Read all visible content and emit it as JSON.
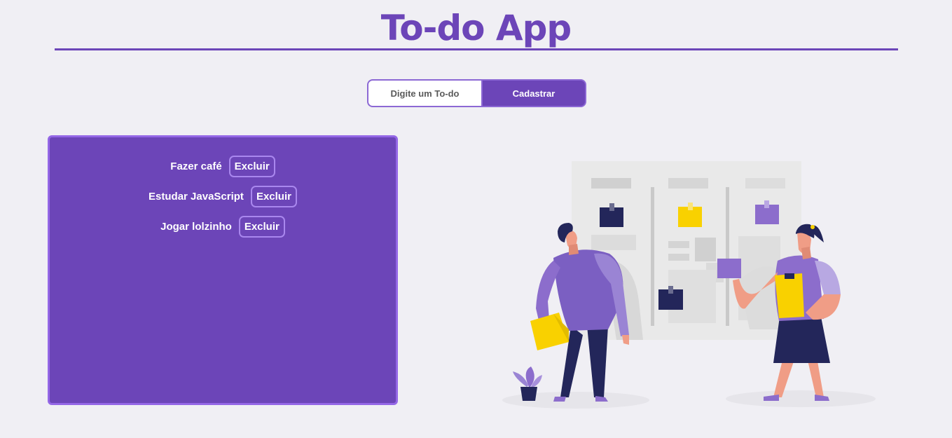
{
  "header": {
    "title": "To-do App"
  },
  "form": {
    "input_placeholder": "Digite um To-do",
    "submit_label": "Cadastrar"
  },
  "todos": [
    {
      "text": "Fazer café",
      "delete_label": "Excluir"
    },
    {
      "text": "Estudar JavaScript",
      "delete_label": "Excluir"
    },
    {
      "text": "Jogar lolzinho",
      "delete_label": "Excluir"
    }
  ],
  "colors": {
    "primary": "#6c45b8",
    "primary_light": "#9467e6",
    "background": "#f0eff4",
    "accent_yellow": "#f9d100",
    "navy": "#23265a"
  },
  "illustration": {
    "icon": "kanban-board-team-illustration"
  }
}
